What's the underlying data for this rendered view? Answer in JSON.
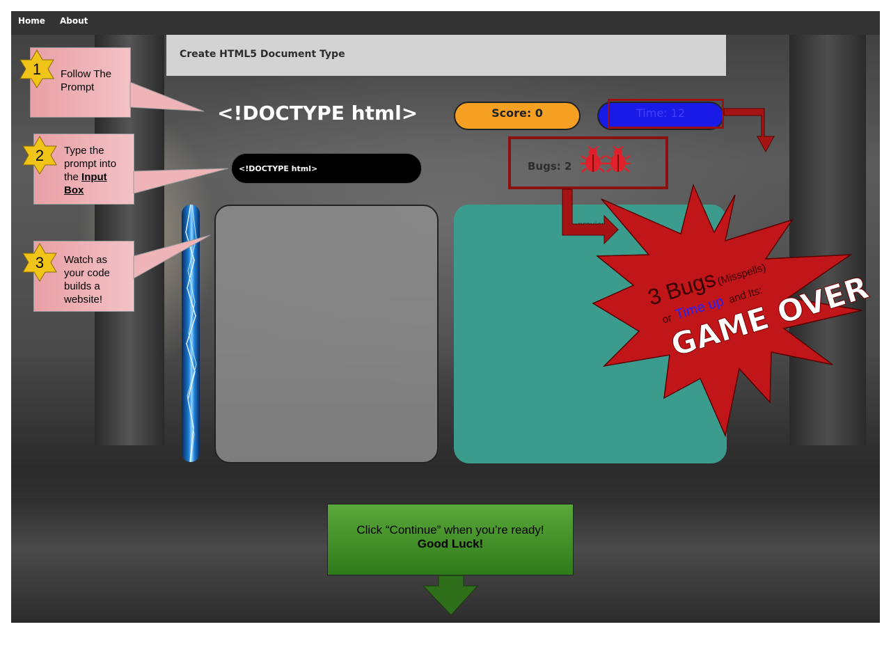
{
  "nav": {
    "home": "Home",
    "about": "About"
  },
  "prompt": {
    "instruction": "Create HTML5 Document Type",
    "target_code": "<!DOCTYPE html>"
  },
  "hud": {
    "score": "Score: 0",
    "time": "Time: 12",
    "bugs": "Bugs: 2",
    "bug_count": 2
  },
  "input": {
    "value": "<!DOCTYPE html>"
  },
  "preview": {
    "label": "preview"
  },
  "callouts": [
    {
      "number": "1",
      "text": "Follow The Prompt"
    },
    {
      "number": "2",
      "text": "Type the prompt into the",
      "link": "Input Box"
    },
    {
      "number": "3",
      "text": "Watch as your code builds a website!"
    }
  ],
  "game_over": {
    "line1": "3 Bugs",
    "line1_small": "(Misspells)",
    "line2_or": "or",
    "line2_time": "Time up",
    "line2_rest": "and Its:",
    "banner": "GAME OVER"
  },
  "continue": {
    "text": "Click “Continue” when you’re ready!",
    "good_luck": "Good Luck!"
  },
  "colors": {
    "score": "#f5a022",
    "timer": "#1a1ae6",
    "callout": "#e8a0a6",
    "burst": "#c0161a",
    "continue": "#3f8f25",
    "preview": "#3b9b8d"
  }
}
